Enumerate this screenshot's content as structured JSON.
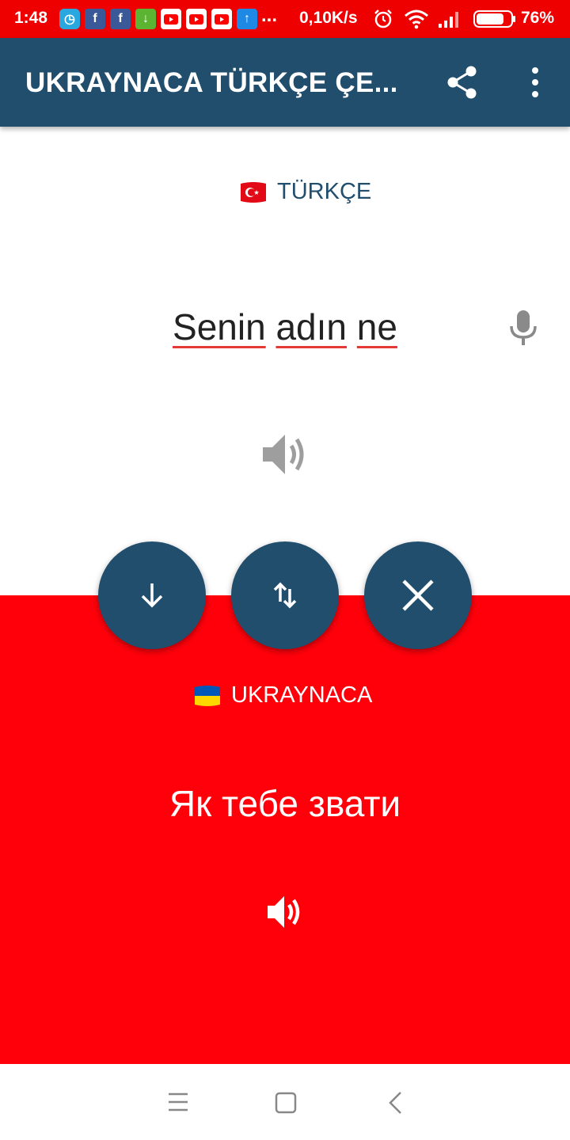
{
  "status_bar": {
    "time": "1:48",
    "more": "...",
    "net_speed": "0,10K/s",
    "battery": "76%"
  },
  "app_bar": {
    "title": "UKRAYNACA TÜRKÇE ÇE..."
  },
  "source": {
    "language": "TÜRKÇE",
    "words": [
      "Senin",
      "adın",
      "ne"
    ]
  },
  "target": {
    "language": "UKRAYNACA",
    "text": "Як тебе звати"
  },
  "colors": {
    "primary": "#224e6d",
    "accent_red": "#ff000b",
    "status_bar": "#ef0000"
  },
  "icons": [
    "share-icon",
    "more-vert-icon",
    "microphone-icon",
    "speaker-icon",
    "arrow-down-icon",
    "swap-icon",
    "close-icon",
    "menu-icon",
    "home-icon",
    "back-icon"
  ]
}
